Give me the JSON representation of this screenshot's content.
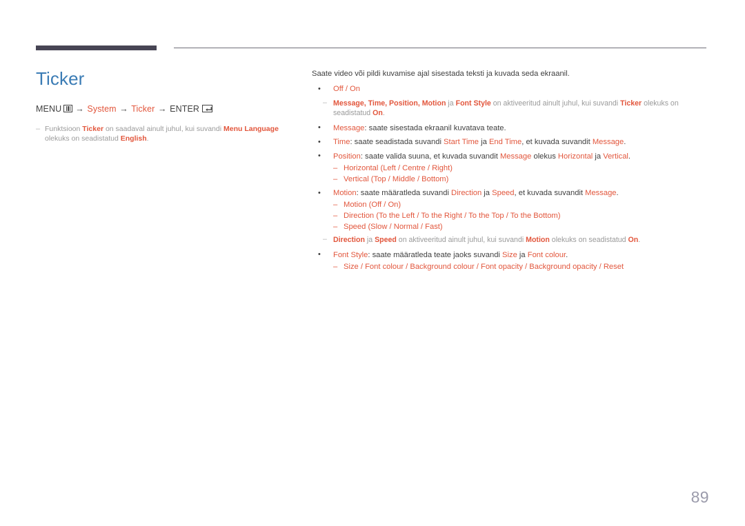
{
  "document": {
    "page_number": "89",
    "accent_orange": "#e2563c",
    "title_blue": "#3b7cb5",
    "note_gray": "#9a9a9a",
    "rule_dark": "#474554"
  },
  "left": {
    "title": "Ticker",
    "menu_path": {
      "menu_label": "MENU",
      "menu_icon": "menu-grid-icon",
      "arrow": "→",
      "step1": "System",
      "step2": "Ticker",
      "enter_label": "ENTER",
      "enter_icon": "enter-key-icon"
    },
    "note": {
      "dash": "–",
      "part1": "Funktsioon ",
      "kw1": "Ticker",
      "part2": " on saadaval ainult juhul, kui suvandi ",
      "kw2": "Menu Language",
      "part3": " olekuks on seadistatud ",
      "kw3": "English",
      "part4": "."
    }
  },
  "right": {
    "intro": "Saate video või pildi kuvamise ajal sisestada teksti ja kuvada seda ekraanil.",
    "items": [
      {
        "id": "off-on",
        "kw": "Off / On"
      },
      {
        "id": "note-message-time",
        "type": "note",
        "kw_list": "Message, Time, Position, Motion",
        "mid1": " ja ",
        "kw2": "Font Style",
        "mid2": " on aktiveeritud ainult juhul, kui suvandi ",
        "kw3": "Ticker",
        "mid3": " olekuks on seadistatud ",
        "kw4": "On",
        "end": "."
      },
      {
        "id": "message",
        "kw": "Message",
        "body": ": saate sisestada ekraanil kuvatava teate."
      },
      {
        "id": "time",
        "kw": "Time",
        "b1": ": saate seadistada suvandi ",
        "kw2": "Start Time",
        "b2": " ja ",
        "kw3": "End Time",
        "b3": ", et kuvada suvandit ",
        "kw4": "Message",
        "b4": "."
      },
      {
        "id": "position",
        "kw": "Position",
        "b1": ": saate valida suuna, et kuvada suvandit ",
        "kw2": "Message",
        "b2": " olekus ",
        "kw3": "Horizontal",
        "b3": " ja ",
        "kw4": "Vertical",
        "b4": ".",
        "subs": [
          "Horizontal (Left / Centre / Right)",
          "Vertical (Top / Middle / Bottom)"
        ]
      },
      {
        "id": "motion",
        "kw": "Motion",
        "b1": ": saate määratleda suvandi ",
        "kw2": "Direction",
        "b2": " ja ",
        "kw3": "Speed",
        "b3": ", et kuvada suvandit ",
        "kw4": "Message",
        "b4": ".",
        "subs": [
          "Motion (Off / On)",
          "Direction (To the Left / To the Right / To the Top / To the Bottom)",
          "Speed (Slow / Normal / Fast)"
        ]
      },
      {
        "id": "note-direction-speed",
        "type": "note",
        "kw_list": "Direction",
        "mid1": " ja ",
        "kw2": "Speed",
        "mid2": " on aktiveeritud ainult juhul, kui suvandi ",
        "kw3": "Motion",
        "mid3": " olekuks on seadistatud ",
        "kw4": "On",
        "end": "."
      },
      {
        "id": "font-style",
        "kw": "Font Style",
        "b1": ": saate määratleda teate jaoks suvandi ",
        "kw2": "Size",
        "b2": " ja ",
        "kw3": "Font colour",
        "b3": ".",
        "subs": [
          "Size / Font colour / Background colour / Font opacity / Background opacity / Reset"
        ]
      }
    ]
  }
}
